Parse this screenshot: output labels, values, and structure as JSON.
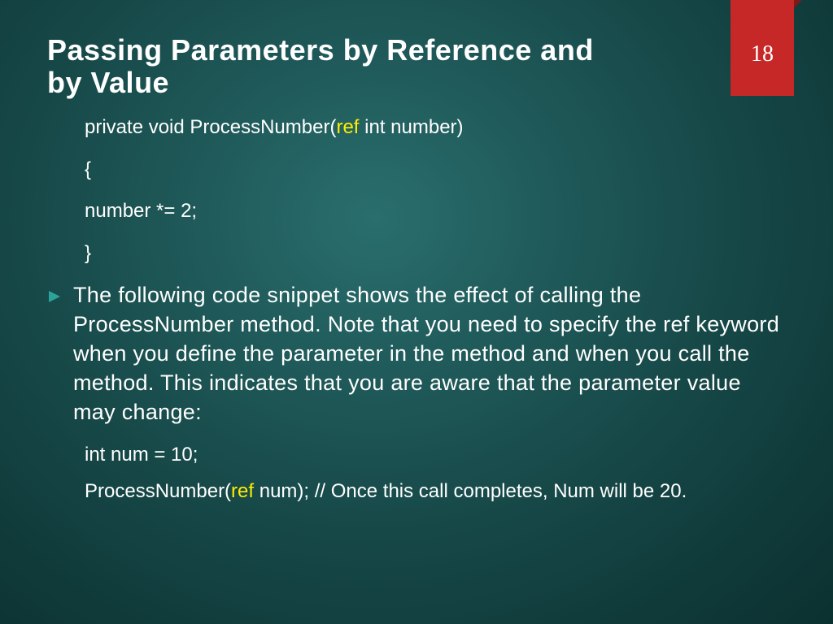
{
  "slide": {
    "number": "18",
    "title": "Passing Parameters by Reference and by Value"
  },
  "code1": {
    "line1_pre": "private void ProcessNumber(",
    "line1_hl": "ref",
    "line1_post": " int number)",
    "line2": "{",
    "line3": "number *= 2;",
    "line4": "}"
  },
  "bullet": {
    "text": "The following code snippet shows the effect of calling the ProcessNumber method. Note that you need to specify the ref keyword when you define the parameter in the method and when you call the method. This indicates that you are aware that the parameter value may change:"
  },
  "code2": {
    "line1": "int num = 10;",
    "line2_pre": "ProcessNumber(",
    "line2_hl": "ref",
    "line2_post": " num); // Once this call completes, Num will be 20."
  }
}
